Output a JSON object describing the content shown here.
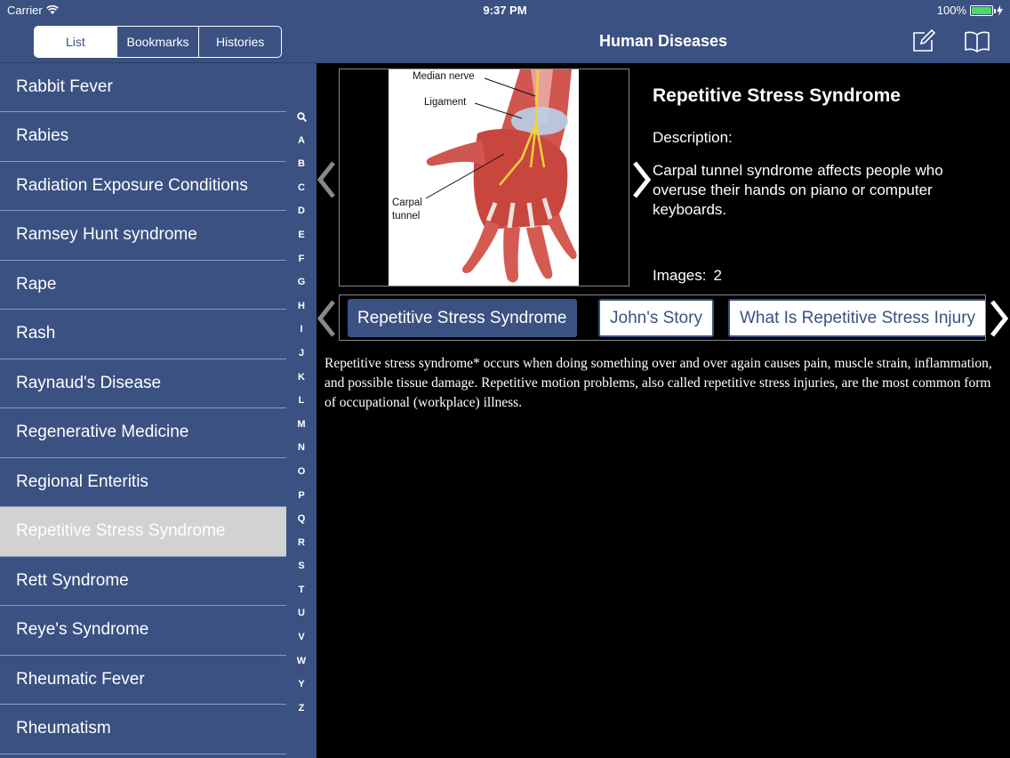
{
  "status_bar": {
    "carrier": "Carrier",
    "time": "9:37 PM",
    "battery_percent": "100%",
    "battery_level": 1.0
  },
  "sidebar": {
    "segments": [
      {
        "label": "List",
        "active": true
      },
      {
        "label": "Bookmarks",
        "active": false
      },
      {
        "label": "Histories",
        "active": false
      }
    ],
    "items": [
      {
        "label": "Rabbit Fever"
      },
      {
        "label": "Rabies"
      },
      {
        "label": "Radiation Exposure Conditions"
      },
      {
        "label": "Ramsey Hunt syndrome"
      },
      {
        "label": "Rape"
      },
      {
        "label": "Rash"
      },
      {
        "label": "Raynaud's Disease"
      },
      {
        "label": "Regenerative Medicine"
      },
      {
        "label": "Regional Enteritis"
      },
      {
        "label": "Repetitive Stress Syndrome",
        "selected": true
      },
      {
        "label": "Rett Syndrome"
      },
      {
        "label": "Reye's Syndrome"
      },
      {
        "label": "Rheumatic Fever"
      },
      {
        "label": "Rheumatism"
      }
    ],
    "index_letters": [
      "A",
      "B",
      "C",
      "D",
      "E",
      "F",
      "G",
      "H",
      "I",
      "J",
      "K",
      "L",
      "M",
      "N",
      "O",
      "P",
      "Q",
      "R",
      "S",
      "T",
      "U",
      "V",
      "W",
      "Y",
      "Z"
    ]
  },
  "navbar": {
    "title": "Human Diseases",
    "compose_icon": "compose-icon",
    "book_icon": "book-icon"
  },
  "detail": {
    "image_labels": {
      "median_nerve": "Median nerve",
      "ligament": "Ligament",
      "carpal_line1": "Carpal",
      "carpal_line2": "tunnel"
    },
    "title": "Repetitive Stress Syndrome",
    "description_label": "Description:",
    "description": "Carpal tunnel syndrome affects people who overuse their hands on piano or computer keyboards.",
    "images_label": "Images:",
    "images_count": "2"
  },
  "tabs": [
    {
      "label": "Repetitive Stress Syndrome",
      "active": true
    },
    {
      "label": "John's Story",
      "active": false
    },
    {
      "label": "What Is Repetitive Stress Injury",
      "active": false
    }
  ],
  "body_text": "Repetitive stress syndrome* occurs when doing something over and over again causes pain, muscle strain, inflammation, and possible tissue damage. Repetitive motion problems, also called repetitive stress injuries, are the most common form of occupational (workplace) illness.",
  "colors": {
    "bar_blue": "#3a5182",
    "selected_row": "#d2d2d2",
    "battery_green": "#4cd964"
  }
}
